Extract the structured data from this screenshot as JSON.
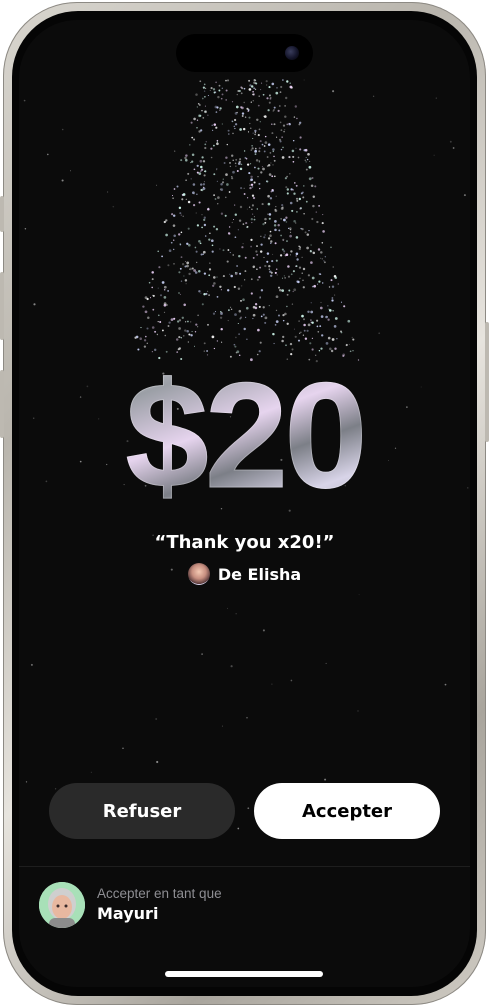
{
  "gift": {
    "amount": "$20",
    "message": "“Thank you x20!”",
    "sender": "De Elisha"
  },
  "actions": {
    "decline_label": "Refuser",
    "accept_label": "Accepter"
  },
  "account": {
    "caption": "Accepter en tant que",
    "name": "Mayuri"
  },
  "colors": {
    "background": "#0b0b0b",
    "decline_button": "#2a2a2a",
    "accept_button": "#ffffff",
    "caption_gray": "#8e8e93"
  },
  "icons": [
    "front-camera-icon",
    "sender-avatar",
    "account-avatar"
  ]
}
